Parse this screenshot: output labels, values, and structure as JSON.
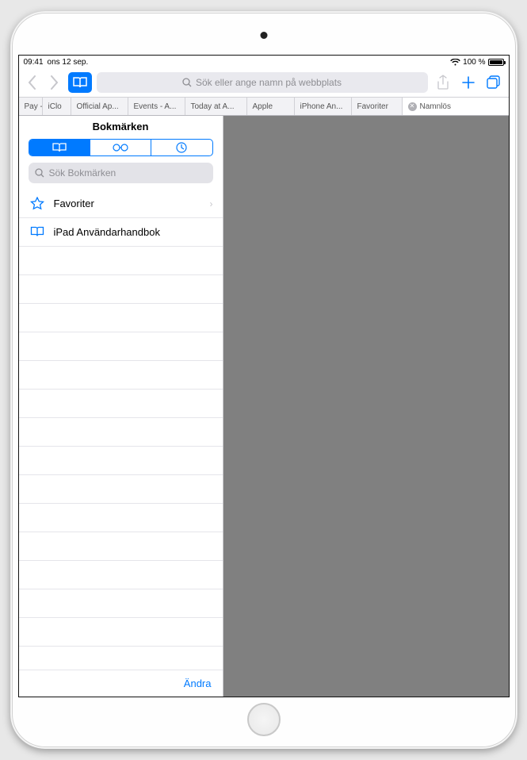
{
  "status": {
    "time": "09:41",
    "date": "ons 12 sep.",
    "battery_pct": "100 %"
  },
  "toolbar": {
    "search_placeholder": "Sök eller ange namn på webbplats"
  },
  "tabs": [
    {
      "label": "Pay -"
    },
    {
      "label": "iClo"
    },
    {
      "label": "Official Ap..."
    },
    {
      "label": "Events - A..."
    },
    {
      "label": "Today at A..."
    },
    {
      "label": "Apple"
    },
    {
      "label": "iPhone An..."
    },
    {
      "label": "Favoriter"
    },
    {
      "label": "Namnlös"
    }
  ],
  "sidebar": {
    "title": "Bokmärken",
    "search_placeholder": "Sök Bokmärken",
    "items": [
      {
        "icon": "star",
        "label": "Favoriter",
        "has_children": true
      },
      {
        "icon": "book",
        "label": "iPad Användarhandbok",
        "has_children": false
      }
    ],
    "edit_label": "Ändra"
  }
}
